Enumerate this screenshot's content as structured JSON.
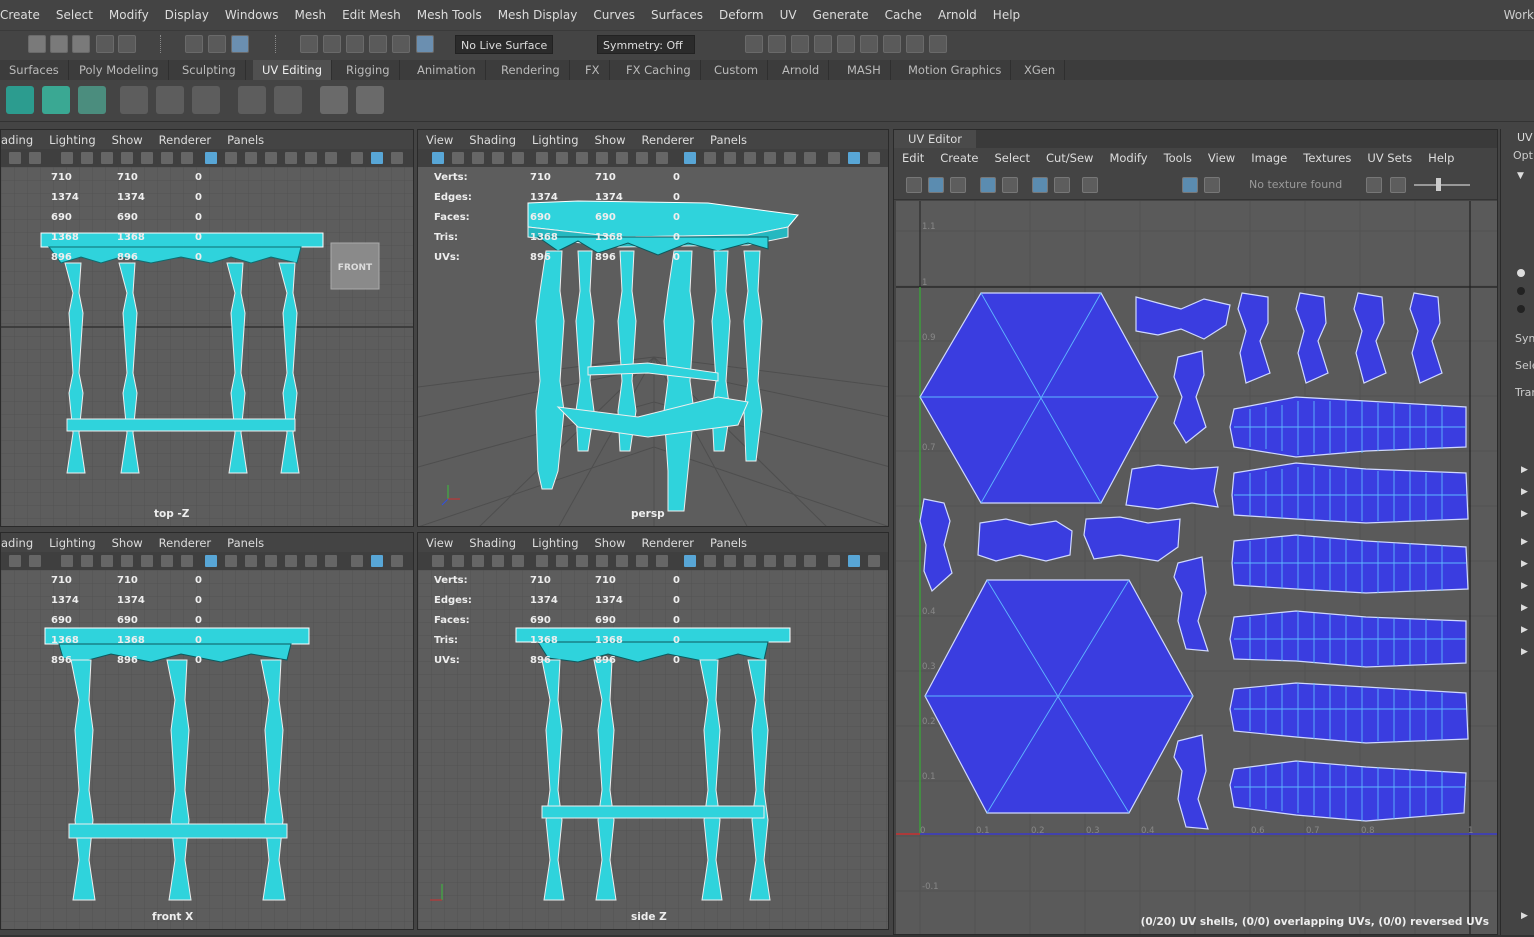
{
  "menubar": {
    "items": [
      "Create",
      "Select",
      "Modify",
      "Display",
      "Windows",
      "Mesh",
      "Edit Mesh",
      "Mesh Tools",
      "Mesh Display",
      "Curves",
      "Surfaces",
      "Deform",
      "UV",
      "Generate",
      "Cache",
      "Arnold",
      "Help"
    ],
    "workspace": "Work"
  },
  "statusline": {
    "live_surface": "No Live Surface",
    "symmetry": "Symmetry: Off"
  },
  "shelf_tabs": [
    "Surfaces",
    "Poly Modeling",
    "Sculpting",
    "UV Editing",
    "Rigging",
    "Animation",
    "Rendering",
    "FX",
    "FX Caching",
    "Custom",
    "Arnold",
    "MASH",
    "Motion Graphics",
    "XGen"
  ],
  "shelf_active": "UV Editing",
  "viewport_menu": [
    "View",
    "Shading",
    "Lighting",
    "Show",
    "Renderer",
    "Panels"
  ],
  "viewport_menu_cut": [
    "ading",
    "Lighting",
    "Show",
    "Renderer",
    "Panels"
  ],
  "hud": {
    "labels": [
      "Verts:",
      "Edges:",
      "Faces:",
      "Tris:",
      "UVs:"
    ],
    "col1": [
      "710",
      "1374",
      "690",
      "1368",
      "896"
    ],
    "col2": [
      "710",
      "1374",
      "690",
      "1368",
      "896"
    ],
    "col3": [
      "0",
      "0",
      "0",
      "0",
      "0"
    ]
  },
  "viewports": {
    "top": {
      "label": "top -Z",
      "cube": "FRONT"
    },
    "persp": {
      "label": "persp"
    },
    "front": {
      "label": "front X"
    },
    "side": {
      "label": "side Z"
    }
  },
  "uv_editor": {
    "title": "UV Editor",
    "menu": [
      "Edit",
      "Create",
      "Select",
      "Cut/Sew",
      "Modify",
      "Tools",
      "View",
      "Image",
      "Textures",
      "UV Sets",
      "Help"
    ],
    "texture": "No texture found",
    "status": "(0/20) UV shells, (0/0) overlapping UVs, (0/0) reversed UVs",
    "axis_labels_y": [
      "1.1",
      "1",
      "0.9",
      "0.7",
      "0.4",
      "0.3",
      "0.2",
      "0.1",
      "-0.1"
    ],
    "axis_labels_x": [
      "0",
      "0.1",
      "0.2",
      "0.3",
      "0.4",
      "0.6",
      "0.7",
      "0.8",
      "1"
    ]
  },
  "rightstrip": {
    "tab": "UV",
    "opt": "Opti",
    "sym": "Sym",
    "sel": "Sele",
    "tran": "Tran"
  },
  "colors": {
    "mesh": "#2fd3dc",
    "uv_shell": "#3a3de0",
    "uv_edge": "#5fb8ff"
  }
}
